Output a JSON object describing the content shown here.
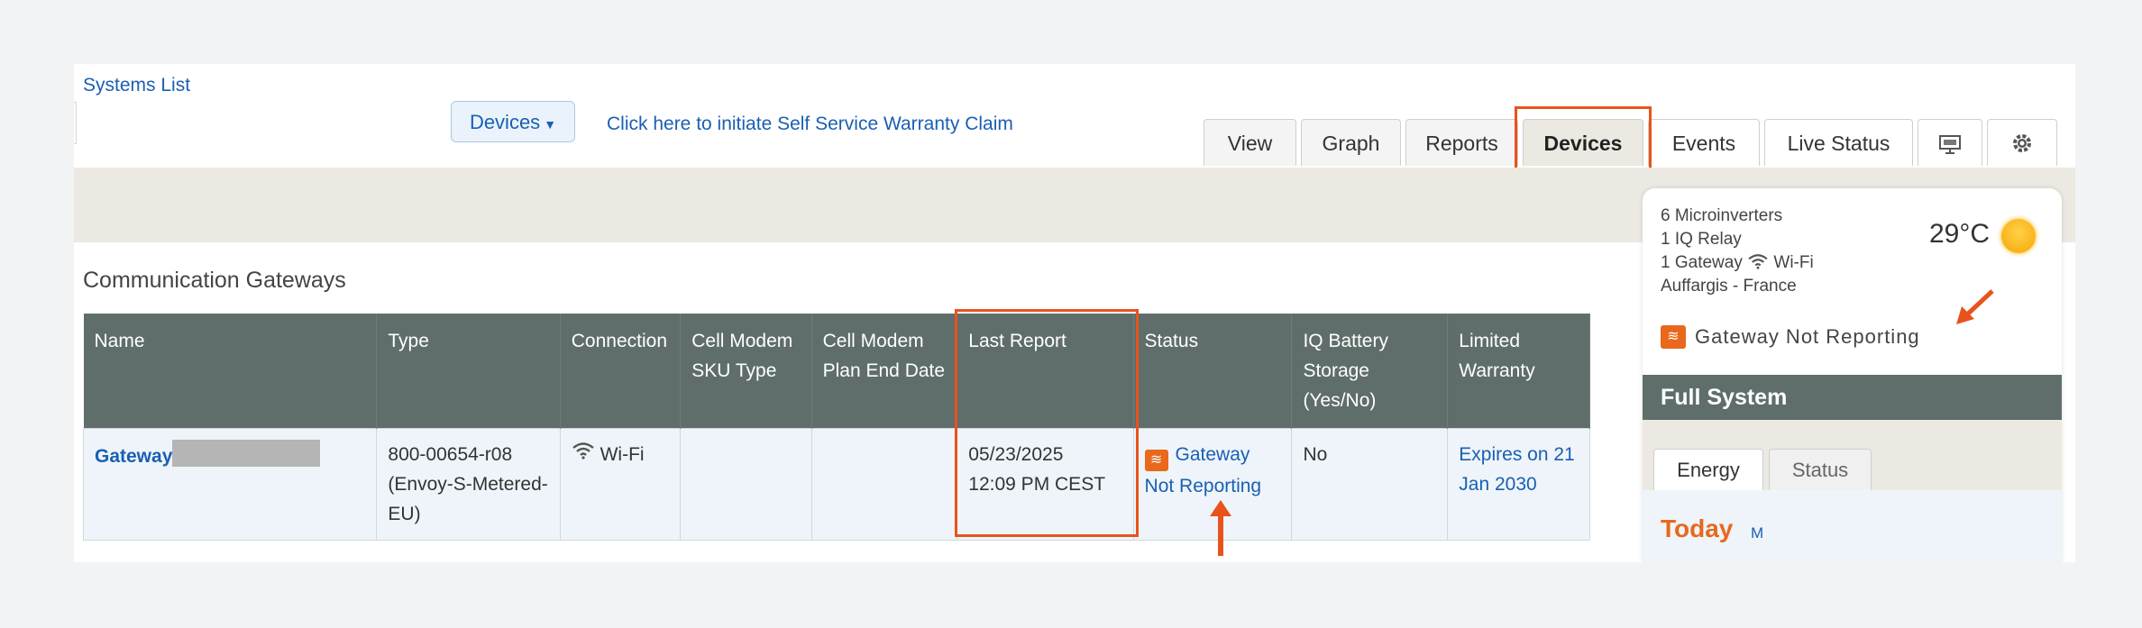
{
  "header": {
    "systems_list": "Systems List",
    "devices_dropdown": "Devices",
    "warranty_link": "Click here to initiate Self Service Warranty Claim"
  },
  "tabs": [
    "View",
    "Graph",
    "Reports",
    "Devices",
    "Events",
    "Live Status"
  ],
  "tab_icons": [
    "monitor-icon",
    "gear-icon"
  ],
  "active_tab": "Devices",
  "gateways": {
    "title": "Communication Gateways",
    "columns": [
      "Name",
      "Type",
      "Connection",
      "Cell Modem SKU Type",
      "Cell Modem Plan End Date",
      "Last Report",
      "Status",
      "IQ Battery Storage (Yes/No)",
      "Limited Warranty"
    ],
    "rows": [
      {
        "name": "Gateway",
        "type": "800-00654-r08 (Envoy-S-Metered-EU)",
        "connection": "Wi-Fi",
        "cell_sku": "",
        "cell_plan_end": "",
        "last_report_date": "05/23/2025",
        "last_report_time": "12:09 PM CEST",
        "status": "Gateway Not Reporting",
        "battery": "No",
        "warranty": "Expires on 21 Jan 2030"
      }
    ]
  },
  "side": {
    "microinverters": "6 Microinverters",
    "relay": "1 IQ Relay",
    "gateway": "1 Gateway",
    "gateway_conn": "Wi-Fi",
    "location": "Auffargis - France",
    "temperature": "29°C",
    "status": "Gateway Not Reporting",
    "full_system": "Full System",
    "tab_energy": "Energy",
    "tab_status": "Status",
    "today": "Today",
    "today_m": "M"
  },
  "colors": {
    "accent": "#e8531c",
    "header_bg": "#5f6e6b",
    "link": "#1a5fb4"
  }
}
